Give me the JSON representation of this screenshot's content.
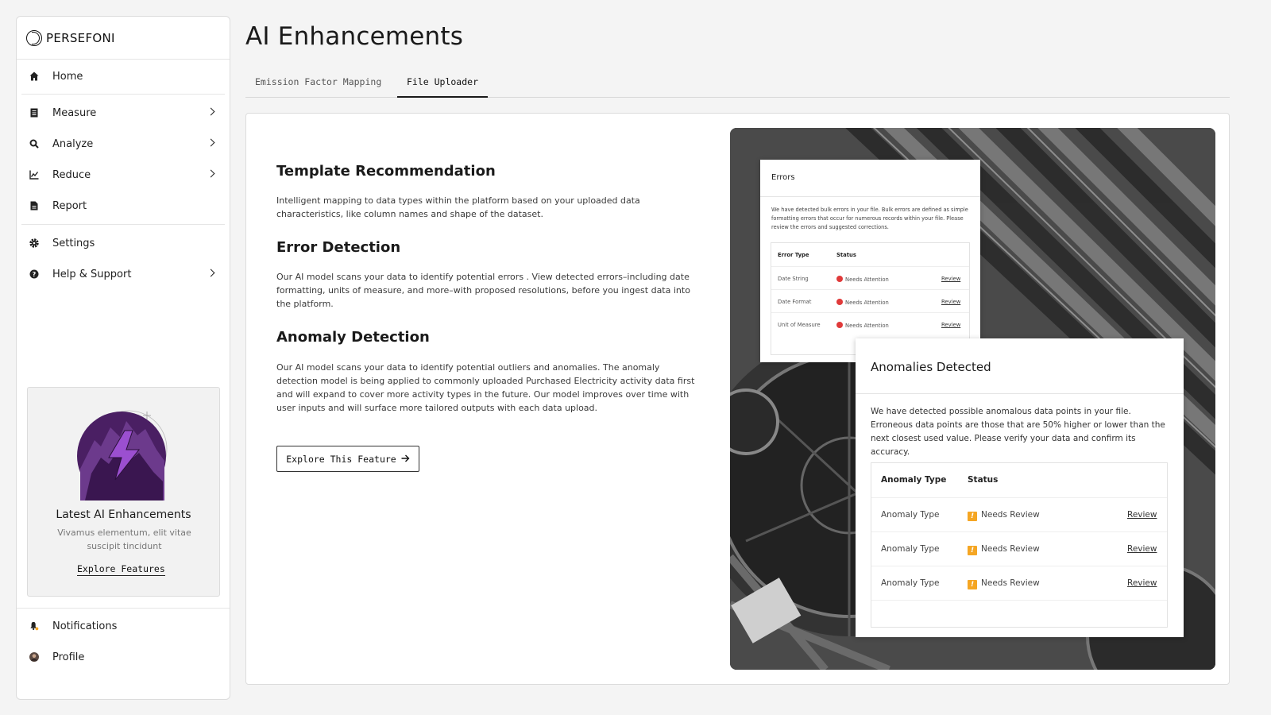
{
  "brand": {
    "name": "PERSEFONI"
  },
  "sidebar": {
    "items": [
      {
        "label": "Home",
        "icon": "home-icon"
      },
      {
        "label": "Measure",
        "icon": "document-icon"
      },
      {
        "label": "Analyze",
        "icon": "search-icon"
      },
      {
        "label": "Reduce",
        "icon": "chart-icon"
      },
      {
        "label": "Report",
        "icon": "report-icon"
      },
      {
        "label": "Settings",
        "icon": "gear-icon"
      },
      {
        "label": "Help & Support",
        "icon": "help-icon"
      }
    ],
    "promo": {
      "title": "Latest AI Enhancements",
      "description": "Vivamus elementum, elit vitae suscipit tincidunt",
      "link": "Explore Features"
    },
    "bottom": [
      {
        "label": "Notifications",
        "icon": "bell-icon"
      },
      {
        "label": "Profile",
        "icon": "avatar"
      }
    ]
  },
  "main": {
    "title": "AI Enhancements",
    "tabs": [
      {
        "label": "Emission Factor Mapping",
        "active": false
      },
      {
        "label": "File Uploader",
        "active": true
      }
    ],
    "sections": [
      {
        "title": "Template Recommendation",
        "body": "Intelligent mapping to data types within the platform based on your uploaded data characteristics, like column names and shape of the dataset."
      },
      {
        "title": "Error Detection",
        "body": "Our AI model scans your data to identify potential errors . View detected errors–including date formatting, units of measure, and more–with proposed resolutions, before you ingest data into the platform."
      },
      {
        "title": "Anomaly Detection",
        "body": "Our AI model scans your data to identify potential outliers and anomalies. The anomaly detection model is being applied to commonly uploaded Purchased Electricity activity data first and will expand to cover more activity types in the future. Our model improves over time with user inputs and will surface more tailored outputs with each data upload."
      }
    ],
    "explore_button": "Explore This Feature"
  },
  "errors_card": {
    "title": "Errors",
    "description": "We have detected bulk errors in your file. Bulk errors are defined as simple formatting errors that occur for numerous records within your file. Please review the errors and suggested corrections.",
    "columns": [
      "Error Type",
      "Status"
    ],
    "rows": [
      {
        "type": "Date String",
        "status": "Needs Attention",
        "action": "Review"
      },
      {
        "type": "Date Format",
        "status": "Needs Attention",
        "action": "Review"
      },
      {
        "type": "Unit of Measure",
        "status": "Needs Attention",
        "action": "Review"
      }
    ]
  },
  "anomalies_card": {
    "title": "Anomalies Detected",
    "description": "We have detected possible anomalous data points in your file. Erroneous data points are those that are 50% higher or lower than the next closest used value. Please verify your data and confirm its accuracy.",
    "columns": [
      "Anomaly Type",
      "Status"
    ],
    "rows": [
      {
        "type": "Anomaly Type",
        "status": "Needs Review",
        "action": "Review"
      },
      {
        "type": "Anomaly Type",
        "status": "Needs Review",
        "action": "Review"
      },
      {
        "type": "Anomaly Type",
        "status": "Needs Review",
        "action": "Review"
      }
    ]
  },
  "colors": {
    "error": "#e03a3a",
    "warning": "#f5a623",
    "promo_purple": "#5b2a7a"
  }
}
